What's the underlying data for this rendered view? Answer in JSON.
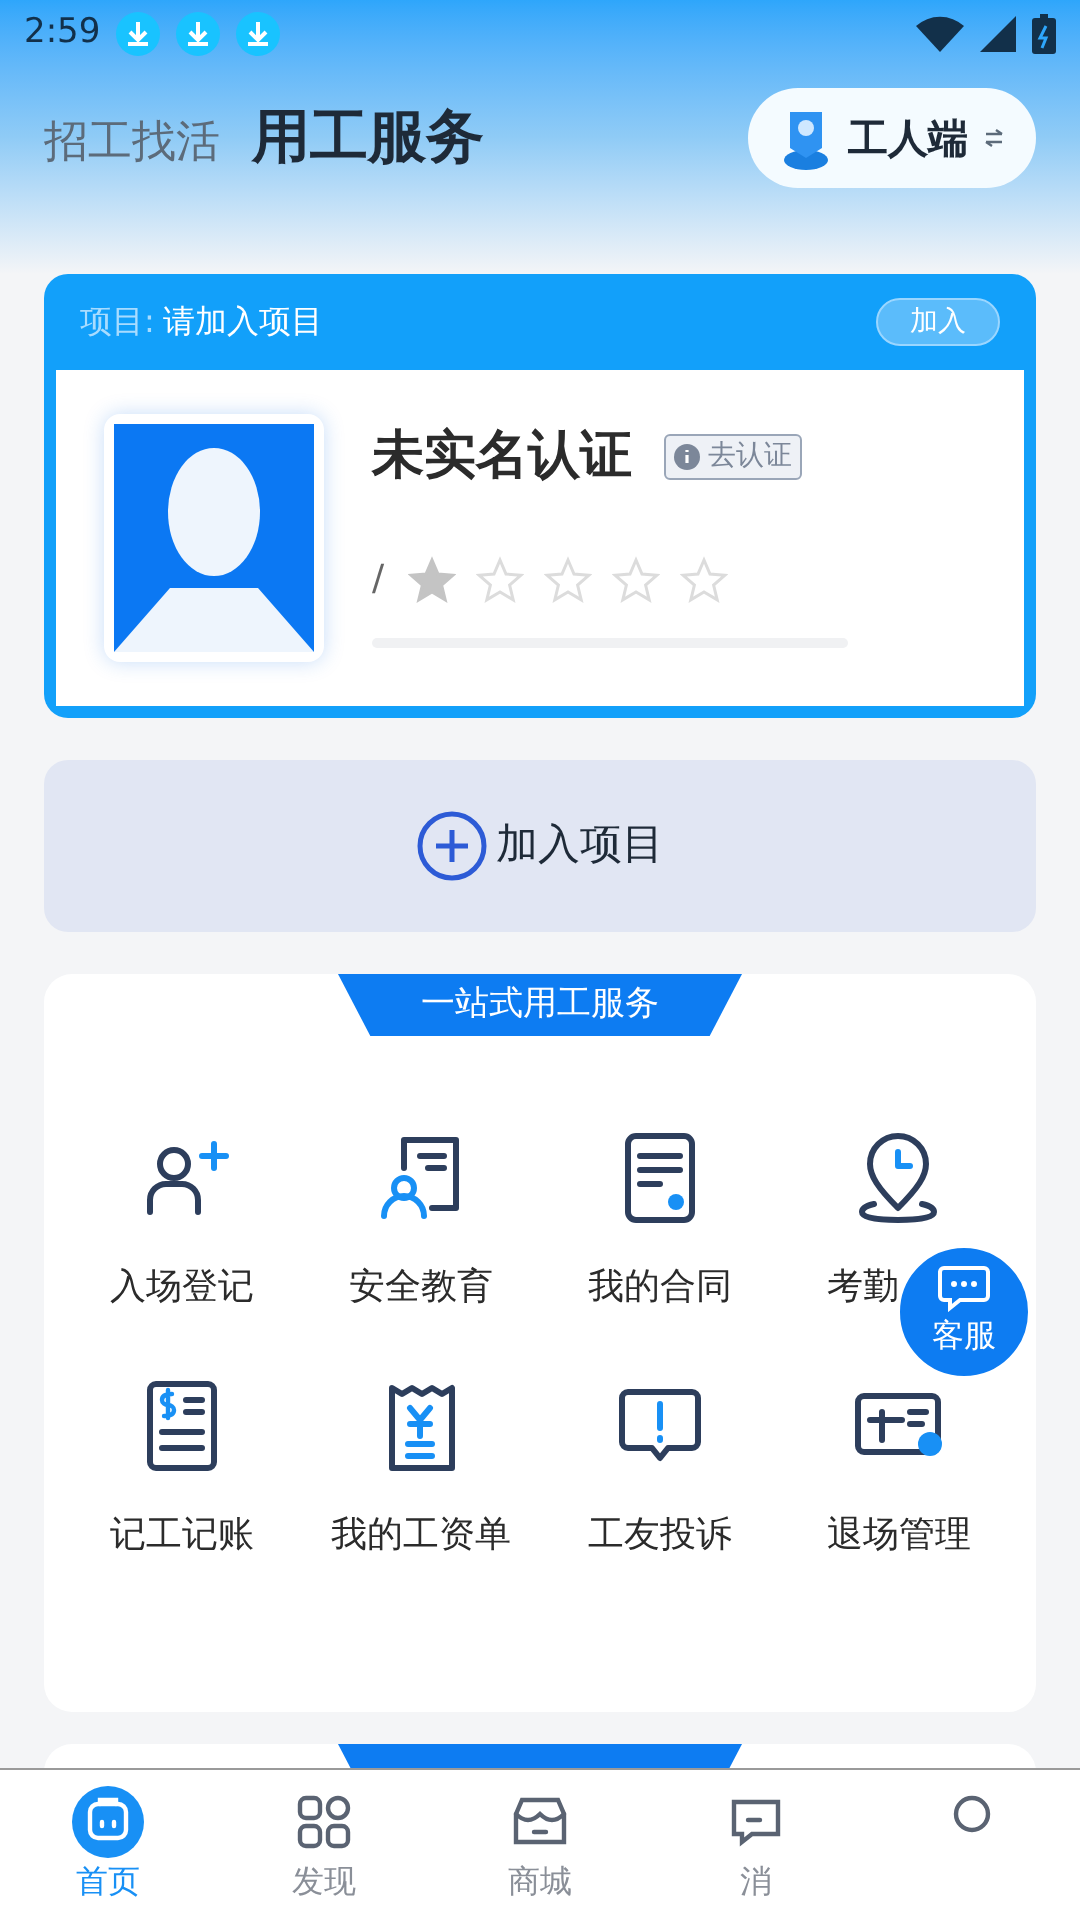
{
  "status_bar": {
    "time": "2:59"
  },
  "header_tabs": [
    {
      "label": "招工找活",
      "selected": false
    },
    {
      "label": "用工服务",
      "selected": true
    }
  ],
  "role_switch": {
    "label": "工人端"
  },
  "project_card": {
    "label": "项目:",
    "value": "请加入项目",
    "join_button": "加入",
    "name": "未实名认证",
    "verify_badge": "去认证",
    "slash": "/",
    "stars": 1
  },
  "join_project_button": "加入项目",
  "services": {
    "title": "一站式用工服务",
    "items": [
      {
        "kind": "person-add",
        "label": "入场登记"
      },
      {
        "kind": "doc-person",
        "label": "安全教育"
      },
      {
        "kind": "contract",
        "label": "我的合同"
      },
      {
        "kind": "location-clock",
        "label": "考勤"
      },
      {
        "kind": "ledger",
        "label": "记工记账"
      },
      {
        "kind": "receipt",
        "label": "我的工资单"
      },
      {
        "kind": "complaint",
        "label": "工友投诉"
      },
      {
        "kind": "exit",
        "label": "退场管理"
      }
    ]
  },
  "float_button": {
    "label": "客服"
  },
  "bottom_nav": [
    {
      "kind": "home",
      "label": "首页",
      "selected": true
    },
    {
      "kind": "discover",
      "label": "发现",
      "selected": false
    },
    {
      "kind": "shop",
      "label": "商城",
      "selected": false
    },
    {
      "kind": "message",
      "label": "消",
      "selected": false
    },
    {
      "kind": "profile",
      "selected": false
    }
  ]
}
